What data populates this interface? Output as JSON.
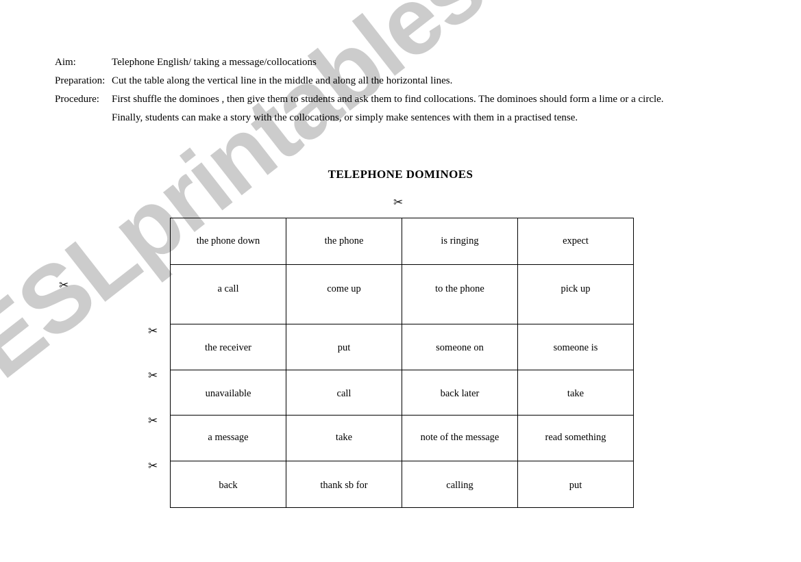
{
  "watermark": {
    "text": "ESLprintables.com",
    "color": "#cccccc"
  },
  "instructions": [
    {
      "label": "Aim:",
      "value": "Telephone English/ taking a message/collocations"
    },
    {
      "label": "Preparation:",
      "value": "Cut the table along the vertical line in the middle and along all the horizontal  lines."
    },
    {
      "label": "Procedure:",
      "value": "First shuffle the dominoes , then give them to  students  and ask them to find collocations. The dominoes should form a lime or a circle.",
      "continuation": "Finally, students can make a story with the collocations, or simply make sentences with them in a practised tense."
    }
  ],
  "title": "TELEPHONE DOMINOES",
  "scissors": {
    "glyph": "✂",
    "name": "scissors-cut-marker"
  },
  "table": {
    "rows": [
      [
        "the phone down",
        "the phone",
        "is ringing",
        "expect"
      ],
      [
        "a call",
        "come up",
        "to the phone",
        "pick up"
      ],
      [
        "the receiver",
        "put",
        "someone on",
        "someone is"
      ],
      [
        "unavailable",
        "call",
        "back later",
        "take"
      ],
      [
        "a message",
        "take",
        "note of the message",
        "read something"
      ],
      [
        "back",
        "thank sb for",
        "calling",
        "put"
      ]
    ]
  }
}
